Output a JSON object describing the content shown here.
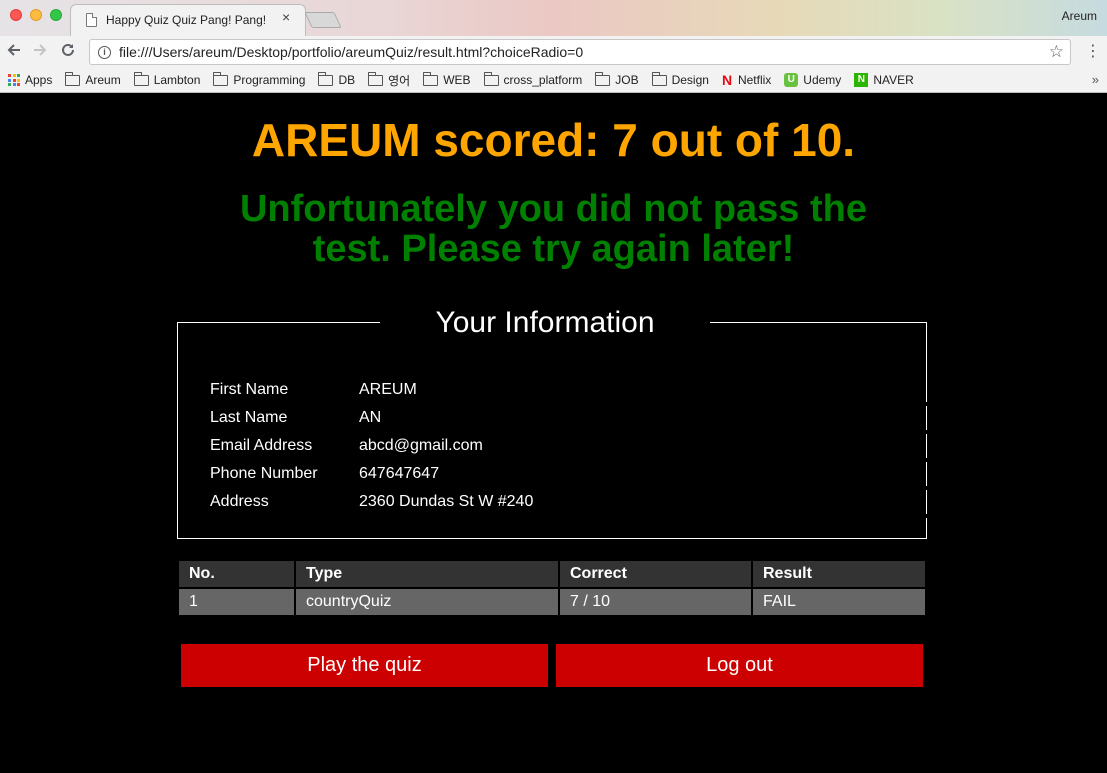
{
  "browser": {
    "tab_title": "Happy Quiz Quiz Pang! Pang!",
    "tab_close": "×",
    "profile": "Areum",
    "url": "file:///Users/areum/Desktop/portfolio/areumQuiz/result.html?choiceRadio=0",
    "icons": {
      "back": "back-arrow-icon",
      "forward": "forward-arrow-icon",
      "reload": "reload-icon",
      "info": "info-icon",
      "star": "bookmark-star-icon",
      "menu": "menu-dots-icon"
    },
    "bookmarks": [
      {
        "label": "Apps",
        "icon": "apps-grid-icon"
      },
      {
        "label": "Areum",
        "icon": "folder-icon"
      },
      {
        "label": "Lambton",
        "icon": "folder-icon"
      },
      {
        "label": "Programming",
        "icon": "folder-icon"
      },
      {
        "label": "DB",
        "icon": "folder-icon"
      },
      {
        "label": "영어",
        "icon": "folder-icon"
      },
      {
        "label": "WEB",
        "icon": "folder-icon"
      },
      {
        "label": "cross_platform",
        "icon": "folder-icon"
      },
      {
        "label": "JOB",
        "icon": "folder-icon"
      },
      {
        "label": "Design",
        "icon": "folder-icon"
      },
      {
        "label": "Netflix",
        "icon": "netflix-icon"
      },
      {
        "label": "Udemy",
        "icon": "udemy-icon"
      },
      {
        "label": "NAVER",
        "icon": "naver-icon"
      }
    ],
    "bookmarks_more": "»"
  },
  "page": {
    "score_text": "AREUM scored: 7 out of 10.",
    "message": "Unfortunately you did not pass the test. Please try again later!",
    "info_title": "Your Information",
    "info_rows": [
      {
        "label": "First Name",
        "value": "AREUM"
      },
      {
        "label": "Last Name",
        "value": "AN"
      },
      {
        "label": "Email Address",
        "value": "abcd@gmail.com"
      },
      {
        "label": "Phone Number",
        "value": "647647647"
      },
      {
        "label": "Address",
        "value": "2360 Dundas St W #240"
      }
    ],
    "table": {
      "headers": [
        "No.",
        "Type",
        "Correct",
        "Result"
      ],
      "rows": [
        [
          "1",
          "countryQuiz",
          "7 / 10",
          "FAIL"
        ]
      ]
    },
    "buttons": {
      "play": "Play the quiz",
      "logout": "Log out"
    },
    "colors": {
      "score": "#ffa500",
      "message": "#008000",
      "button": "#cc0000",
      "table_header": "#333333",
      "table_cell": "#666666"
    }
  }
}
